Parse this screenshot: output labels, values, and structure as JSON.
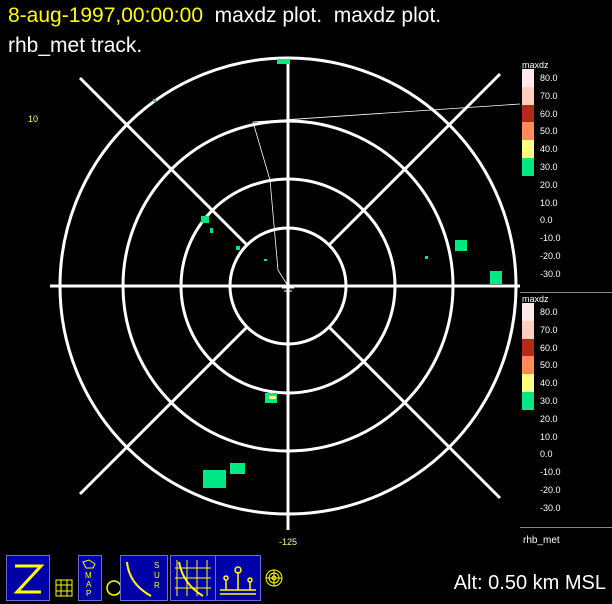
{
  "title": {
    "date": "8-aug-1997,00:00:00",
    "plot1": "maxdz plot.",
    "plot2": "maxdz plot.",
    "line2": "rhb_met track."
  },
  "axis": {
    "y_label": "10",
    "x_label": "-125"
  },
  "legends": [
    {
      "title": "maxdz",
      "entries": [
        {
          "value": "80.0",
          "color": "#ffe8e8"
        },
        {
          "value": "70.0",
          "color": "#ffd0c0"
        },
        {
          "value": "60.0",
          "color": "#b22a18"
        },
        {
          "value": "50.0",
          "color": "#ff8a5a"
        },
        {
          "value": "40.0",
          "color": "#ffff80"
        },
        {
          "value": "30.0",
          "color": "#00e884"
        },
        {
          "value": "20.0",
          "color": ""
        },
        {
          "value": "10.0",
          "color": ""
        },
        {
          "value": "0.0",
          "color": ""
        },
        {
          "value": "-10.0",
          "color": ""
        },
        {
          "value": "-20.0",
          "color": ""
        },
        {
          "value": "-30.0",
          "color": ""
        }
      ]
    },
    {
      "title": "maxdz",
      "entries": [
        {
          "value": "80.0",
          "color": "#ffe8e8"
        },
        {
          "value": "70.0",
          "color": "#ffd0c0"
        },
        {
          "value": "60.0",
          "color": "#b22a18"
        },
        {
          "value": "50.0",
          "color": "#ff8a5a"
        },
        {
          "value": "40.0",
          "color": "#ffff80"
        },
        {
          "value": "30.0",
          "color": "#00e884"
        },
        {
          "value": "20.0",
          "color": ""
        },
        {
          "value": "10.0",
          "color": ""
        },
        {
          "value": "0.0",
          "color": ""
        },
        {
          "value": "-10.0",
          "color": ""
        },
        {
          "value": "-20.0",
          "color": ""
        },
        {
          "value": "-30.0",
          "color": ""
        }
      ]
    }
  ],
  "track_label": "rhb_met",
  "status": {
    "altitude": "Alt: 0.50 km MSL"
  },
  "colors": {
    "echo": "#00e884",
    "date": "#ffff00",
    "toolbar_bg": "#0000a8"
  },
  "toolbar": {
    "buttons": [
      {
        "icon": "zoom-z-icon"
      },
      {
        "icon": "grid-icon"
      },
      {
        "icon": "map-icon"
      },
      {
        "icon": "circle-icon"
      },
      {
        "icon": "surface-icon"
      },
      {
        "icon": "grid-overlay-icon"
      },
      {
        "icon": "station-icon"
      },
      {
        "icon": "range-rings-icon"
      }
    ]
  }
}
